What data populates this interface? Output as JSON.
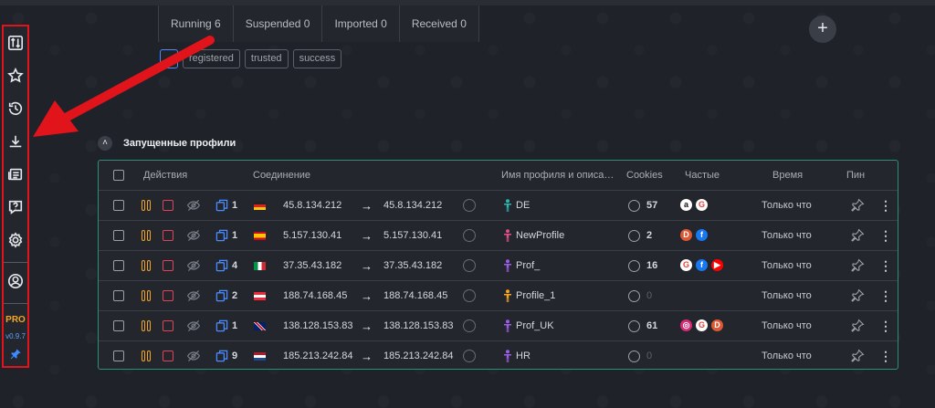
{
  "tabs": [
    {
      "label": "Running 6"
    },
    {
      "label": "Suspended 0"
    },
    {
      "label": "Imported 0"
    },
    {
      "label": "Received 0"
    }
  ],
  "add_button": {
    "label": "+"
  },
  "filters": [
    {
      "label": ""
    },
    {
      "label": "registered"
    },
    {
      "label": "trusted"
    },
    {
      "label": "success"
    }
  ],
  "sidebar": {
    "items": [
      {
        "icon": "sort-icon"
      },
      {
        "icon": "star-icon"
      },
      {
        "icon": "history-icon"
      },
      {
        "icon": "download-icon"
      },
      {
        "icon": "news-icon"
      },
      {
        "icon": "help-icon"
      },
      {
        "icon": "gear-icon"
      },
      {
        "icon": "user-icon"
      }
    ],
    "pro_label": "PRO",
    "version": "v0.9.7",
    "accent": "#f5a623",
    "version_color": "#5aa3ff"
  },
  "section": {
    "title": "Запущенные профили",
    "collapse_symbol": "˄"
  },
  "table": {
    "headers": {
      "actions": "Действия",
      "connection": "Соединение",
      "profile": "Имя профиля и описа…",
      "cookies": "Cookies",
      "frequent": "Частые",
      "time": "Время",
      "pin": "Пин"
    },
    "rows": [
      {
        "tabs": "1",
        "flag": "de",
        "ip_in": "45.8.134.212",
        "ip_out": "45.8.134.212",
        "person_color": "#2bb5b0",
        "name": "DE",
        "cookies": "57",
        "cookies_dim": false,
        "sites": [
          "amazon",
          "google"
        ],
        "time": "Только что"
      },
      {
        "tabs": "1",
        "flag": "es",
        "ip_in": "5.157.130.41",
        "ip_out": "5.157.130.41",
        "person_color": "#e0508a",
        "name": "NewProfile",
        "cookies": "2",
        "cookies_dim": false,
        "sites": [
          "duckduckgo",
          "facebook"
        ],
        "time": "Только что"
      },
      {
        "tabs": "4",
        "flag": "it",
        "ip_in": "37.35.43.182",
        "ip_out": "37.35.43.182",
        "person_color": "#9b5de5",
        "name": "Prof_",
        "cookies": "16",
        "cookies_dim": false,
        "sites": [
          "google",
          "facebook",
          "youtube"
        ],
        "time": "Только что"
      },
      {
        "tabs": "2",
        "flag": "at",
        "ip_in": "188.74.168.45",
        "ip_out": "188.74.168.45",
        "person_color": "#f5a623",
        "name": "Profile_1",
        "cookies": "0",
        "cookies_dim": true,
        "sites": [],
        "time": "Только что"
      },
      {
        "tabs": "1",
        "flag": "gb",
        "ip_in": "138.128.153.83",
        "ip_out": "138.128.153.83",
        "person_color": "#9b5de5",
        "name": "Prof_UK",
        "cookies": "61",
        "cookies_dim": false,
        "sites": [
          "instagram",
          "google",
          "duckduckgo"
        ],
        "time": "Только что"
      },
      {
        "tabs": "9",
        "flag": "nl",
        "ip_in": "185.213.242.84",
        "ip_out": "185.213.242.84",
        "person_color": "#9b5de5",
        "name": "HR",
        "cookies": "0",
        "cookies_dim": true,
        "sites": [],
        "time": "Только что"
      }
    ]
  },
  "colors": {
    "background": "#1f2229",
    "table_border": "#2e8f7a",
    "highlight_red": "#e0141a",
    "pause": "#f5a623",
    "stop": "#e0445a",
    "tabs_icon": "#4a8cff"
  }
}
